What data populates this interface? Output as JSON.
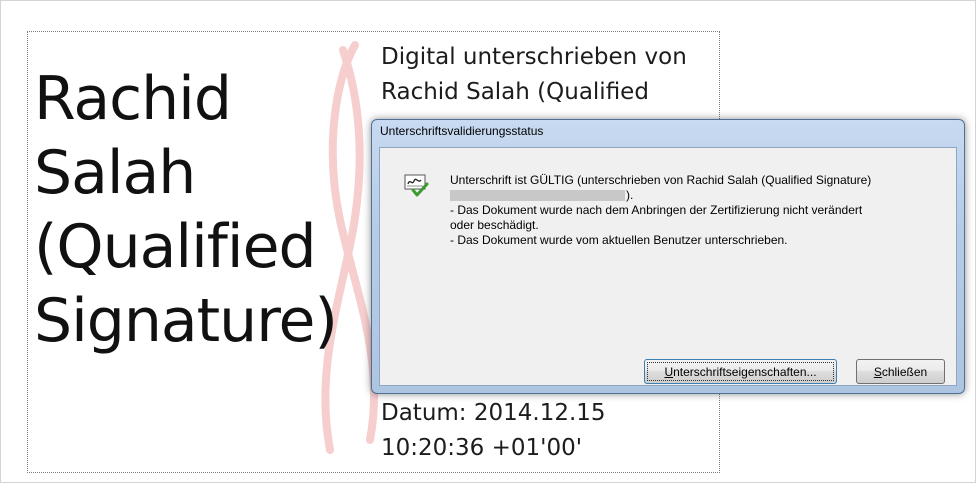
{
  "signature_field": {
    "name_lines": [
      "Rachid",
      "Salah",
      "(Qualified",
      "Signature)"
    ],
    "detail_lines": [
      "Digital unterschrieben von",
      "Rachid Salah (Qualified"
    ],
    "date_lines": [
      "Datum: 2014.12.15",
      "10:20:36 +01'00'"
    ]
  },
  "dialog": {
    "title": "Unterschriftsvalidierungsstatus",
    "message_line1": "Unterschrift ist GÜLTIG (unterschrieben von Rachid Salah (Qualified Signature)",
    "message_line2_tail": ").",
    "message_line3": "- Das Dokument wurde nach dem Anbringen der Zertifizierung nicht verändert",
    "message_line4": "oder beschädigt.",
    "message_line5": "- Das Dokument wurde vom aktuellen Benutzer unterschrieben.",
    "props_button_mnemonic": "U",
    "props_button_rest": "nterschriftseigenschaften...",
    "close_button_mnemonic": "S",
    "close_button_rest": "chließen"
  },
  "colors": {
    "dialog_frame": "#b5cbe6",
    "client_bg": "#f0f0f0",
    "logo_stroke": "#f2b8b8"
  },
  "icons": {
    "status": "signature-valid-icon"
  }
}
